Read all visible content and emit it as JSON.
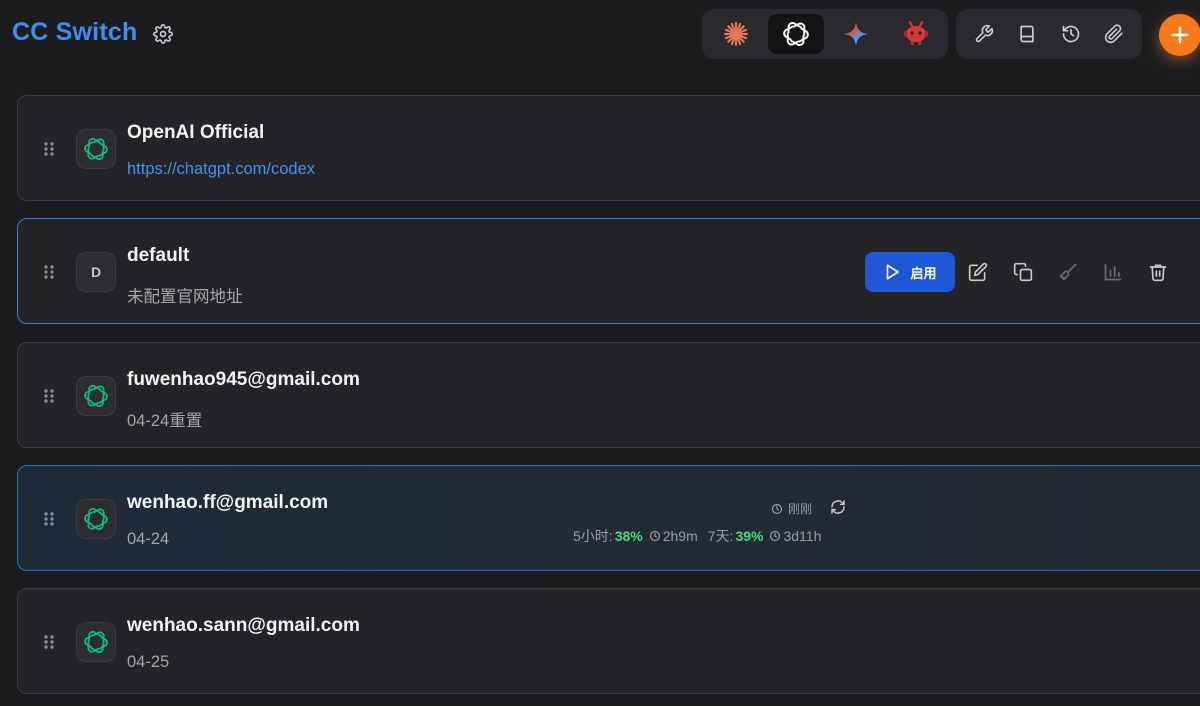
{
  "header": {
    "title": "CC Switch",
    "apps": [
      {
        "name": "claude",
        "icon": "claude-asterisk-icon",
        "color": "#e4765a"
      },
      {
        "name": "codex",
        "icon": "openai-icon",
        "active": true
      },
      {
        "name": "gemini",
        "icon": "gemini-sparkle-icon"
      },
      {
        "name": "other",
        "icon": "red-robot-icon",
        "color": "#d8373a"
      }
    ],
    "tools": [
      "wrench-icon",
      "book-icon",
      "history-icon",
      "paperclip-icon"
    ],
    "add_color": "#f47a1c"
  },
  "providers": [
    {
      "name": "OpenAI Official",
      "subtitle": "https://chatgpt.com/codex",
      "icon": "openai-icon"
    },
    {
      "name": "default",
      "subtitle": "未配置官网地址",
      "avatar_letter": "D"
    },
    {
      "name": "fuwenhao945@gmail.com",
      "subtitle": "04-24重置",
      "icon": "openai-icon"
    },
    {
      "name": "wenhao.ff@gmail.com",
      "subtitle": "04-24",
      "icon": "openai-icon"
    },
    {
      "name": "wenhao.sann@gmail.com",
      "subtitle": "04-25",
      "icon": "openai-icon"
    }
  ],
  "actions": {
    "enable_label": "启用",
    "icons": [
      "edit-icon",
      "copy-icon",
      "test-brush-icon",
      "usage-chart-icon",
      "trash-icon"
    ]
  },
  "usage": {
    "updated": "刚刚",
    "five_hour_label": "5小时:",
    "five_hour_pct": "38%",
    "five_hour_reset": "2h9m",
    "seven_day_label": "7天:",
    "seven_day_pct": "39%",
    "seven_day_reset": "3d11h"
  },
  "colors": {
    "accent": "#3b8ff0",
    "primary_button": "#1f57d6",
    "usage_green": "#3ddc84",
    "openai_green": "#10b981"
  }
}
